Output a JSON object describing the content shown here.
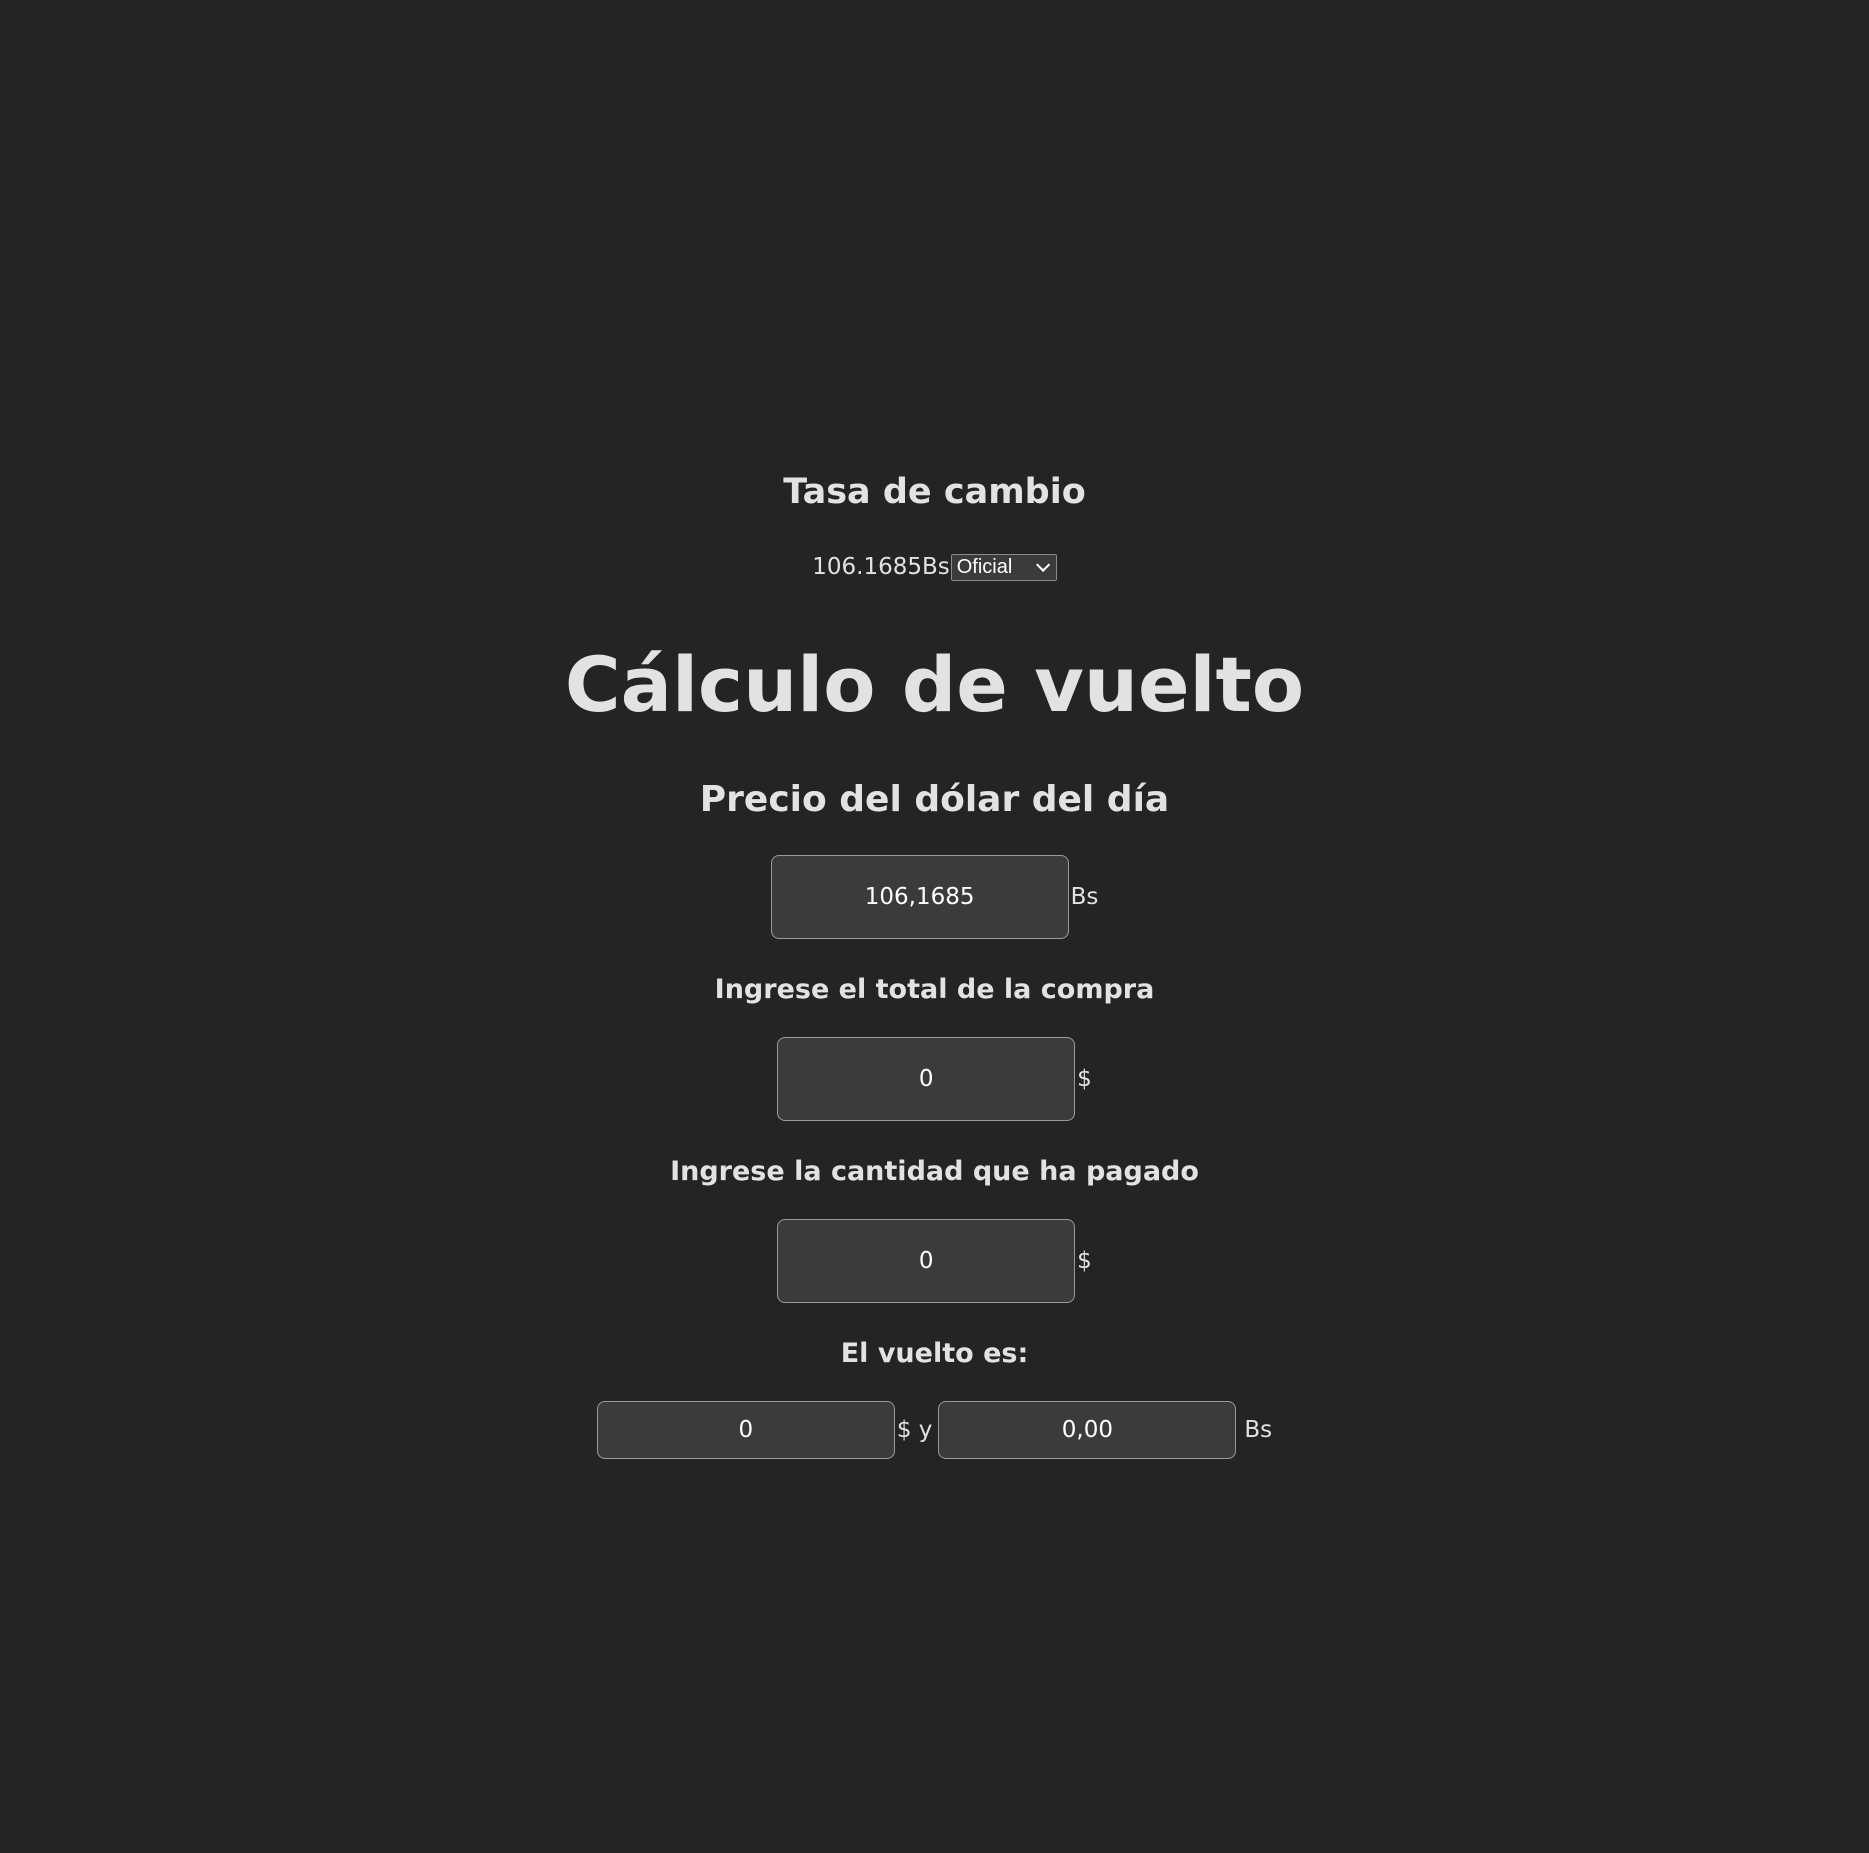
{
  "exchange": {
    "heading": "Tasa de cambio",
    "rate_text": "106.1685Bs",
    "selected_option": "Oficial"
  },
  "title": "Cálculo de vuelto",
  "dollar_price": {
    "heading": "Precio del dólar del día",
    "value": "106,1685",
    "unit": "Bs"
  },
  "purchase_total": {
    "label": "Ingrese el total de la compra",
    "value": "0",
    "unit": "$"
  },
  "amount_paid": {
    "label": "Ingrese la cantidad que ha pagado",
    "value": "0",
    "unit": "$"
  },
  "change": {
    "label": "El vuelto es:",
    "usd_value": "0",
    "usd_unit": "$ y",
    "bs_value": "0,00",
    "bs_unit": "Bs"
  }
}
